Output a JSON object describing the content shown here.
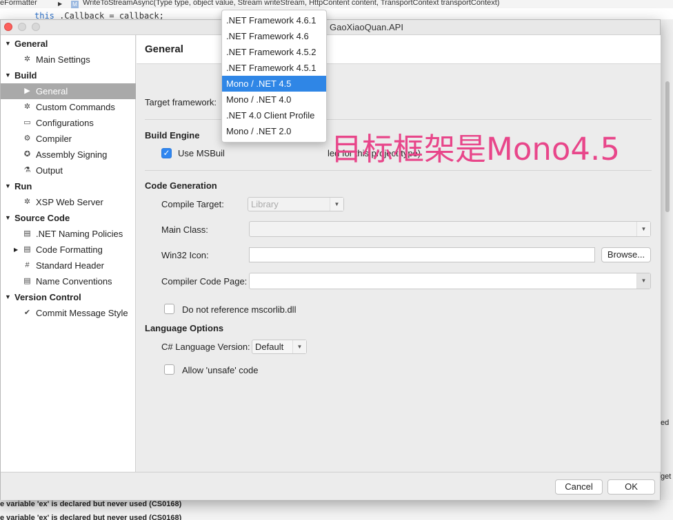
{
  "background": {
    "breadcrumb_left": "eFormatter",
    "breadcrumb_method": "WriteToStreamAsync(Type type, object value, Stream writeStream, HttpContent content, TransportContext transportContext)",
    "code_keyword": "this",
    "code_rest": ".Callback = callback;",
    "right_text_1": "ed",
    "right_text_2": "get",
    "errors": [
      "e variable 'ex' is declared but never used (CS0168)",
      "e variable 'ex' is declared but never used (CS0168)"
    ]
  },
  "window": {
    "title": "GaoXiaoQuan.API"
  },
  "sidebar": {
    "rows": [
      {
        "type": "category",
        "label": "General"
      },
      {
        "type": "item",
        "label": "Main Settings",
        "icon": "gear-icon",
        "glyph": "✲"
      },
      {
        "type": "category",
        "label": "Build"
      },
      {
        "type": "item",
        "label": "General",
        "icon": "play-icon",
        "glyph": "▶",
        "selected": true
      },
      {
        "type": "item",
        "label": "Custom Commands",
        "icon": "gear-icon",
        "glyph": "✲"
      },
      {
        "type": "item",
        "label": "Configurations",
        "icon": "window-icon",
        "glyph": "▭"
      },
      {
        "type": "item",
        "label": "Compiler",
        "icon": "cog-icon",
        "glyph": "⚙"
      },
      {
        "type": "item",
        "label": "Assembly Signing",
        "icon": "badge-icon",
        "glyph": "✪"
      },
      {
        "type": "item",
        "label": "Output",
        "icon": "flask-icon",
        "glyph": "⚗"
      },
      {
        "type": "category",
        "label": "Run"
      },
      {
        "type": "item",
        "label": "XSP Web Server",
        "icon": "gear-icon",
        "glyph": "✲"
      },
      {
        "type": "category",
        "label": "Source Code"
      },
      {
        "type": "item",
        "label": ".NET Naming Policies",
        "icon": "doc-icon",
        "glyph": "▤"
      },
      {
        "type": "item",
        "label": "Code Formatting",
        "icon": "doc-icon",
        "glyph": "▤",
        "expandable": true
      },
      {
        "type": "item",
        "label": "Standard Header",
        "icon": "hash-icon",
        "glyph": "#"
      },
      {
        "type": "item",
        "label": "Name Conventions",
        "icon": "doc-icon",
        "glyph": "▤"
      },
      {
        "type": "category",
        "label": "Version Control"
      },
      {
        "type": "item",
        "label": "Commit Message Style",
        "icon": "check-circle-icon",
        "glyph": "✔"
      }
    ]
  },
  "content": {
    "header": "General",
    "target_framework_label": "Target framework:",
    "build_engine": {
      "title": "Build Engine",
      "use_msbuild_label": "Use MSBuil",
      "use_msbuild_suffix": "led for this project type)",
      "checked": true
    },
    "code_generation": {
      "title": "Code Generation",
      "compile_target_label": "Compile Target:",
      "compile_target_value": "Library",
      "main_class_label": "Main Class:",
      "win32_icon_label": "Win32 Icon:",
      "browse_label": "Browse...",
      "compiler_code_page_label": "Compiler Code Page:",
      "no_mscorlib_label": "Do not reference mscorlib.dll"
    },
    "language_options": {
      "title": "Language Options",
      "csharp_version_label": "C# Language Version:",
      "csharp_version_value": "Default",
      "unsafe_label": "Allow 'unsafe' code"
    }
  },
  "dropdown": {
    "options": [
      ".NET Framework 4.6.1",
      ".NET Framework 4.6",
      ".NET Framework 4.5.2",
      ".NET Framework 4.5.1",
      "Mono / .NET 4.5",
      "Mono / .NET 4.0",
      ".NET 4.0 Client Profile",
      "Mono / .NET 2.0"
    ],
    "selected": "Mono / .NET 4.5"
  },
  "annotation": "目标框架是Mono4.5",
  "footer": {
    "cancel": "Cancel",
    "ok": "OK"
  },
  "colors": {
    "selection": "#2f86e6",
    "annotation": "#e8468a",
    "sidebar_selected": "#a9a9a9"
  }
}
